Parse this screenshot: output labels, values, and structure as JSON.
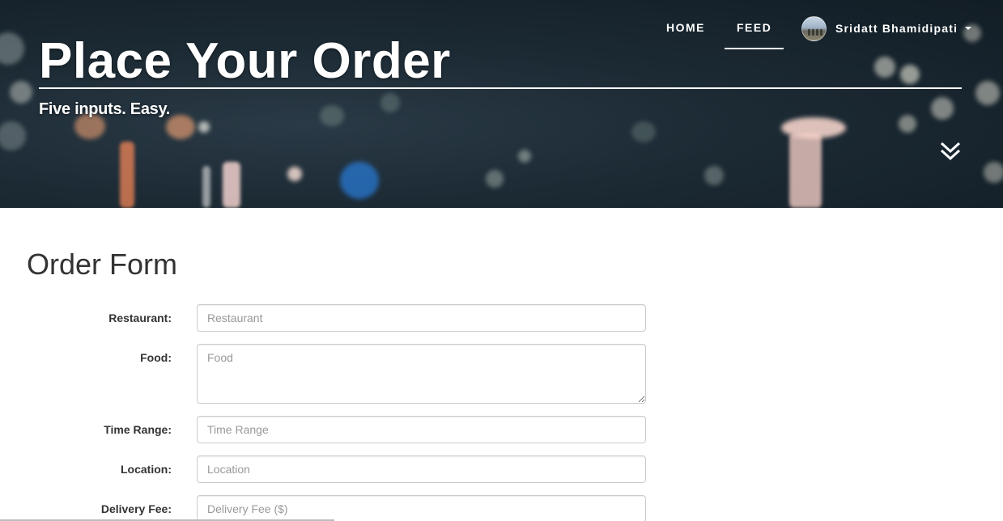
{
  "hero": {
    "title": "Place Your Order",
    "subtitle": "Five inputs. Easy."
  },
  "nav": {
    "home": "HOME",
    "feed": "FEED",
    "active": "FEED",
    "user_name": "Sridatt Bhamidipati"
  },
  "form": {
    "title": "Order Form",
    "fields": [
      {
        "label": "Restaurant:",
        "placeholder": "Restaurant",
        "value": ""
      },
      {
        "label": "Food:",
        "placeholder": "Food",
        "value": ""
      },
      {
        "label": "Time Range:",
        "placeholder": "Time Range",
        "value": ""
      },
      {
        "label": "Location:",
        "placeholder": "Location",
        "value": ""
      },
      {
        "label": "Delivery Fee:",
        "placeholder": "Delivery Fee ($)",
        "value": ""
      }
    ]
  },
  "icons": {
    "scroll_down": "double-chevron-down-icon",
    "user_menu": "caret-down-icon"
  },
  "colors": {
    "hero_bg": "#1c2a34",
    "text_white": "#ffffff",
    "heading": "#333333",
    "input_border": "#cccccc",
    "placeholder": "#999999"
  }
}
